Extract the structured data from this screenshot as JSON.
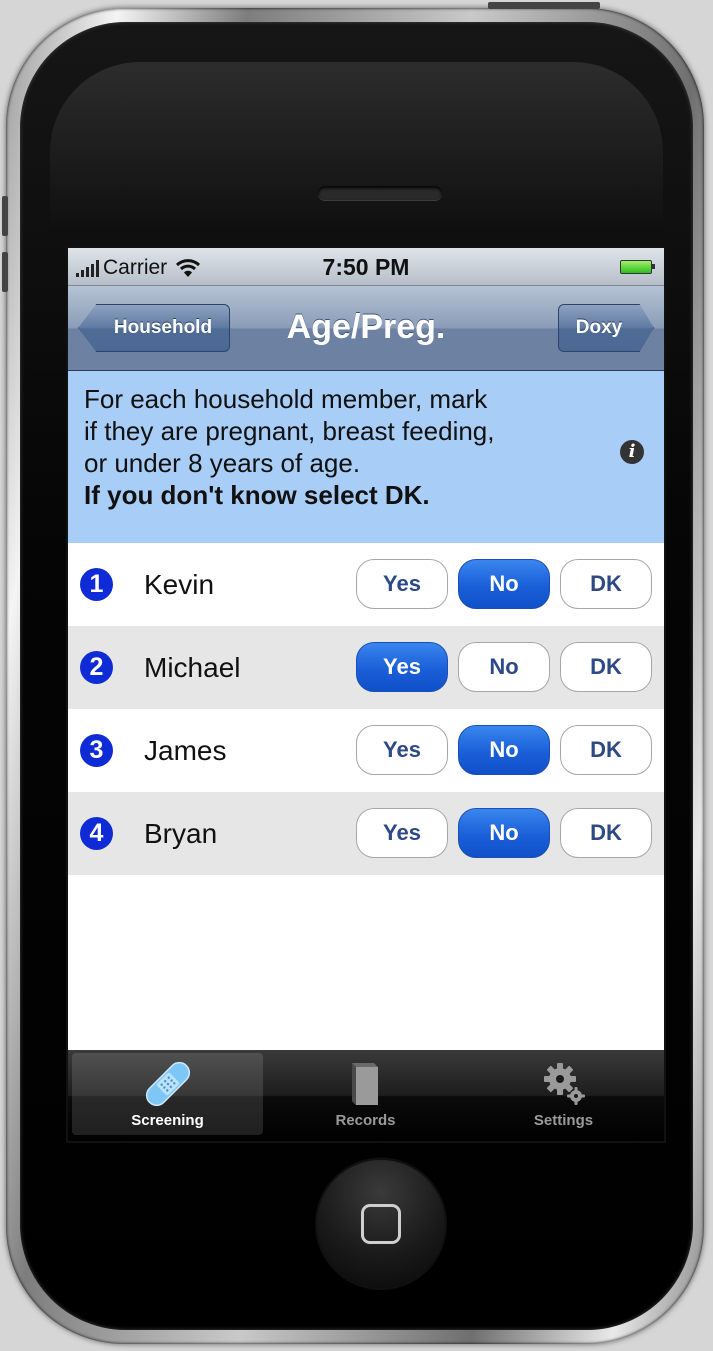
{
  "status_bar": {
    "carrier": "Carrier",
    "time": "7:50 PM"
  },
  "nav": {
    "back_label": "Household",
    "title": "Age/Preg.",
    "forward_label": "Doxy"
  },
  "instructions": {
    "lines": [
      "For each household member, mark",
      "if they are pregnant, breast feeding,",
      "or under 8 years of age."
    ],
    "bold_line": "If you don't know select DK."
  },
  "choice_labels": {
    "yes": "Yes",
    "no": "No",
    "dk": "DK"
  },
  "members": [
    {
      "number": "1",
      "name": "Kevin",
      "selected": "No"
    },
    {
      "number": "2",
      "name": "Michael",
      "selected": "Yes"
    },
    {
      "number": "3",
      "name": "James",
      "selected": "No"
    },
    {
      "number": "4",
      "name": "Bryan",
      "selected": "No"
    }
  ],
  "tabs": [
    {
      "label": "Screening",
      "icon": "bandage-icon",
      "active": true
    },
    {
      "label": "Records",
      "icon": "book-icon",
      "active": false
    },
    {
      "label": "Settings",
      "icon": "gears-icon",
      "active": false
    }
  ],
  "colors": {
    "selected_choice": "#1a5fd8",
    "instructions_bg": "#a8cdf6",
    "number_badge": "#0e2bd6"
  }
}
